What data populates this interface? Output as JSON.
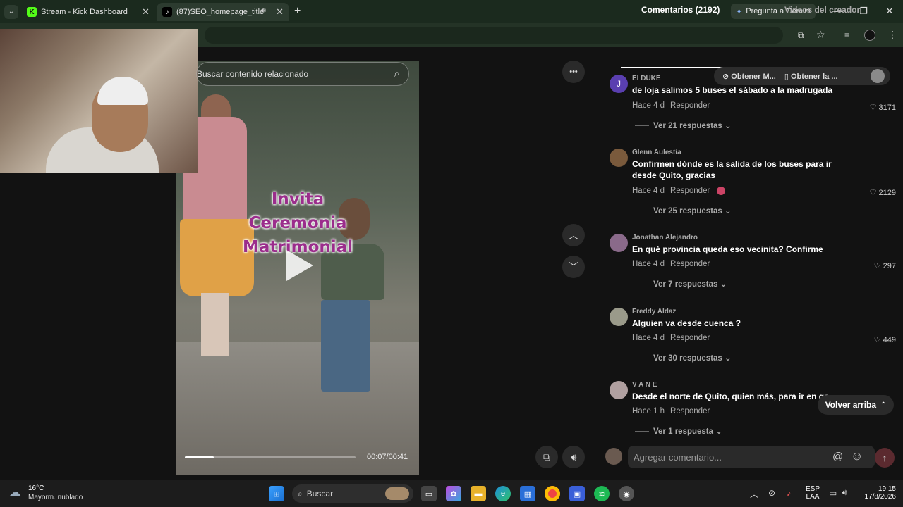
{
  "browser": {
    "tabs": [
      {
        "label": "Stream - Kick Dashboard",
        "icon": "kick-icon",
        "favicon_text": "K"
      },
      {
        "label": "(87)SEO_homepage_title",
        "icon": "tiktok-icon",
        "favicon_text": "♪"
      }
    ],
    "new_tab": "+",
    "gemini_label": "Pregunta a Gemini",
    "gemini_star": "✦"
  },
  "video": {
    "search_placeholder": "Buscar contenido relacionado",
    "overlay_lines": [
      "Invita",
      "Ceremonia",
      "Matrimonial"
    ],
    "time": "00:07/00:41",
    "progress": 0.17,
    "more": "•••"
  },
  "comments_panel": {
    "tab_comments": "Comentarios (2192)",
    "tab_videos": "Videos del creador",
    "ext_buttons": [
      "Obtener M...",
      "Obtener la ..."
    ],
    "items": [
      {
        "name": "El DUKE",
        "avatar_letter": "J",
        "avatar_color": "#5a3fb0",
        "text": "de loja salimos 5 buses el sábado a la madrugada",
        "time": "Hace 4 d",
        "reply": "Responder",
        "likes": "3171",
        "replies": "Ver 21 respuestas"
      },
      {
        "name": "Glenn Aulestia",
        "avatar_letter": "",
        "avatar_color": "#7a5a3c",
        "text": "Confirmen dónde es la salida de los buses para ir desde Quito, gracias",
        "time": "Hace 4 d",
        "reply": "Responder",
        "likes": "2129",
        "replies": "Ver 25 respuestas"
      },
      {
        "name": "Jonathan Alejandro",
        "avatar_letter": "",
        "avatar_color": "#8a6a8a",
        "text": "En qué provincia queda eso vecinita? Confirme",
        "time": "Hace 4 d",
        "reply": "Responder",
        "likes": "297",
        "replies": "Ver 7 respuestas"
      },
      {
        "name": "Freddy Aldaz",
        "avatar_letter": "",
        "avatar_color": "#9a9a8a",
        "text": "Alguien va desde cuenca ?",
        "time": "Hace 4 d",
        "reply": "Responder",
        "likes": "449",
        "replies": "Ver 30 respuestas"
      },
      {
        "name": "V A N E",
        "avatar_letter": "",
        "avatar_color": "#b0a0a0",
        "text": "Desde el norte de Quito, quien más, para ir en gr",
        "time": "Hace 1 h",
        "reply": "Responder",
        "likes": "",
        "replies": "Ver 1 respuesta"
      }
    ],
    "back_to_top": "Volver arriba",
    "input_placeholder": "Agregar comentario...",
    "at_symbol": "@",
    "emoji_symbol": "☺"
  },
  "taskbar": {
    "weather_temp": "16°C",
    "weather_desc": "Mayorm. nublado",
    "search_label": "Buscar",
    "lang": "ESP",
    "lang_sub": "LAA",
    "time": "19:15",
    "date": "17/8/2026"
  }
}
